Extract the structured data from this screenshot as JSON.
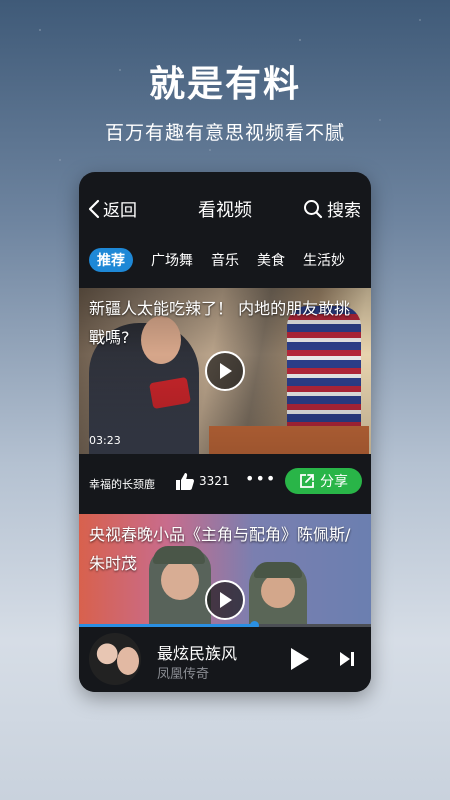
{
  "promo": {
    "headline": "就是有料",
    "subline": "百万有趣有意思视频看不腻"
  },
  "header": {
    "back_label": "返回",
    "title": "看视频",
    "search_label": "搜索"
  },
  "categories": [
    {
      "label": "推荐",
      "active": true
    },
    {
      "label": "广场舞",
      "active": false
    },
    {
      "label": "音乐",
      "active": false
    },
    {
      "label": "美食",
      "active": false
    },
    {
      "label": "生活妙",
      "active": false
    }
  ],
  "videos": [
    {
      "title": "新疆人太能吃辣了！ 内地的朋友敢挑戰嗎?",
      "duration": "03:23",
      "author": "幸福的长颈鹿",
      "likes": "3321",
      "more": "•••",
      "share_label": "分享"
    },
    {
      "title": "央视春晚小品《主角与配角》陈佩斯/朱时茂"
    }
  ],
  "playback": {
    "progress": 0.6
  },
  "player": {
    "song": "最炫民族风",
    "artist": "凤凰传奇"
  },
  "colors": {
    "accent": "#1e88d6",
    "share": "#29b548",
    "panel": "#15171b"
  }
}
